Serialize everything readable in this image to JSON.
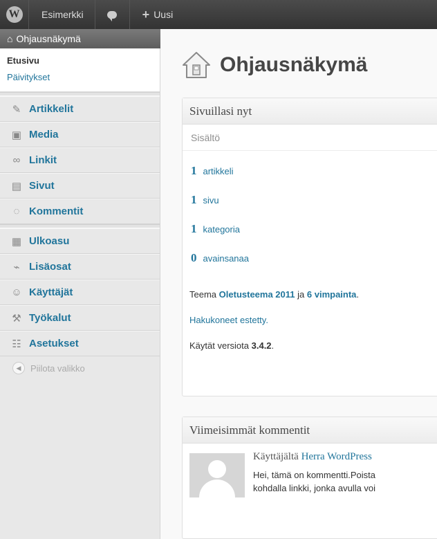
{
  "adminbar": {
    "logo": "wordpress-logo",
    "site_name": "Esimerkki",
    "comments_icon": "comment-bubble-icon",
    "new_label": "Uusi"
  },
  "sidebar": {
    "dashboard": {
      "label": "Ohjausnäkymä",
      "icon": "home-icon",
      "submenu": [
        "Etusivu",
        "Päivitykset"
      ]
    },
    "items": [
      {
        "label": "Artikkelit",
        "icon": "pin-icon"
      },
      {
        "label": "Media",
        "icon": "media-icon"
      },
      {
        "label": "Linkit",
        "icon": "link-icon"
      },
      {
        "label": "Sivut",
        "icon": "pages-icon"
      },
      {
        "label": "Kommentit",
        "icon": "comments-icon"
      },
      {
        "label": "Ulkoasu",
        "icon": "appearance-icon"
      },
      {
        "label": "Lisäosat",
        "icon": "plugins-icon"
      },
      {
        "label": "Käyttäjät",
        "icon": "users-icon"
      },
      {
        "label": "Työkalut",
        "icon": "tools-icon"
      },
      {
        "label": "Asetukset",
        "icon": "settings-icon"
      }
    ],
    "collapse_label": "Piilota valikko"
  },
  "main": {
    "title": "Ohjausnäkymä",
    "right_now": {
      "title": "Sivuillasi nyt",
      "content_label": "Sisältö",
      "stats": [
        {
          "num": "1",
          "label": "artikkeli"
        },
        {
          "num": "1",
          "label": "sivu"
        },
        {
          "num": "1",
          "label": "kategoria"
        },
        {
          "num": "0",
          "label": "avainsanaa"
        }
      ],
      "theme_prefix": "Teema",
      "theme_name": "Oletusteema 2011",
      "theme_mid": "ja",
      "widgets": "6 vimpainta",
      "theme_suffix": ".",
      "search_engines": "Hakukoneet estetty.",
      "version_prefix": "Käytät versiota",
      "version": "3.4.2",
      "version_suffix": "."
    },
    "recent_comments": {
      "title": "Viimeisimmät kommentit",
      "author_prefix": "Käyttäjältä",
      "author": "Herra WordPress",
      "text_line1": "Hei, tämä on kommentti.Poista",
      "text_line2": "kohdalla linkki, jonka avulla voi"
    }
  }
}
